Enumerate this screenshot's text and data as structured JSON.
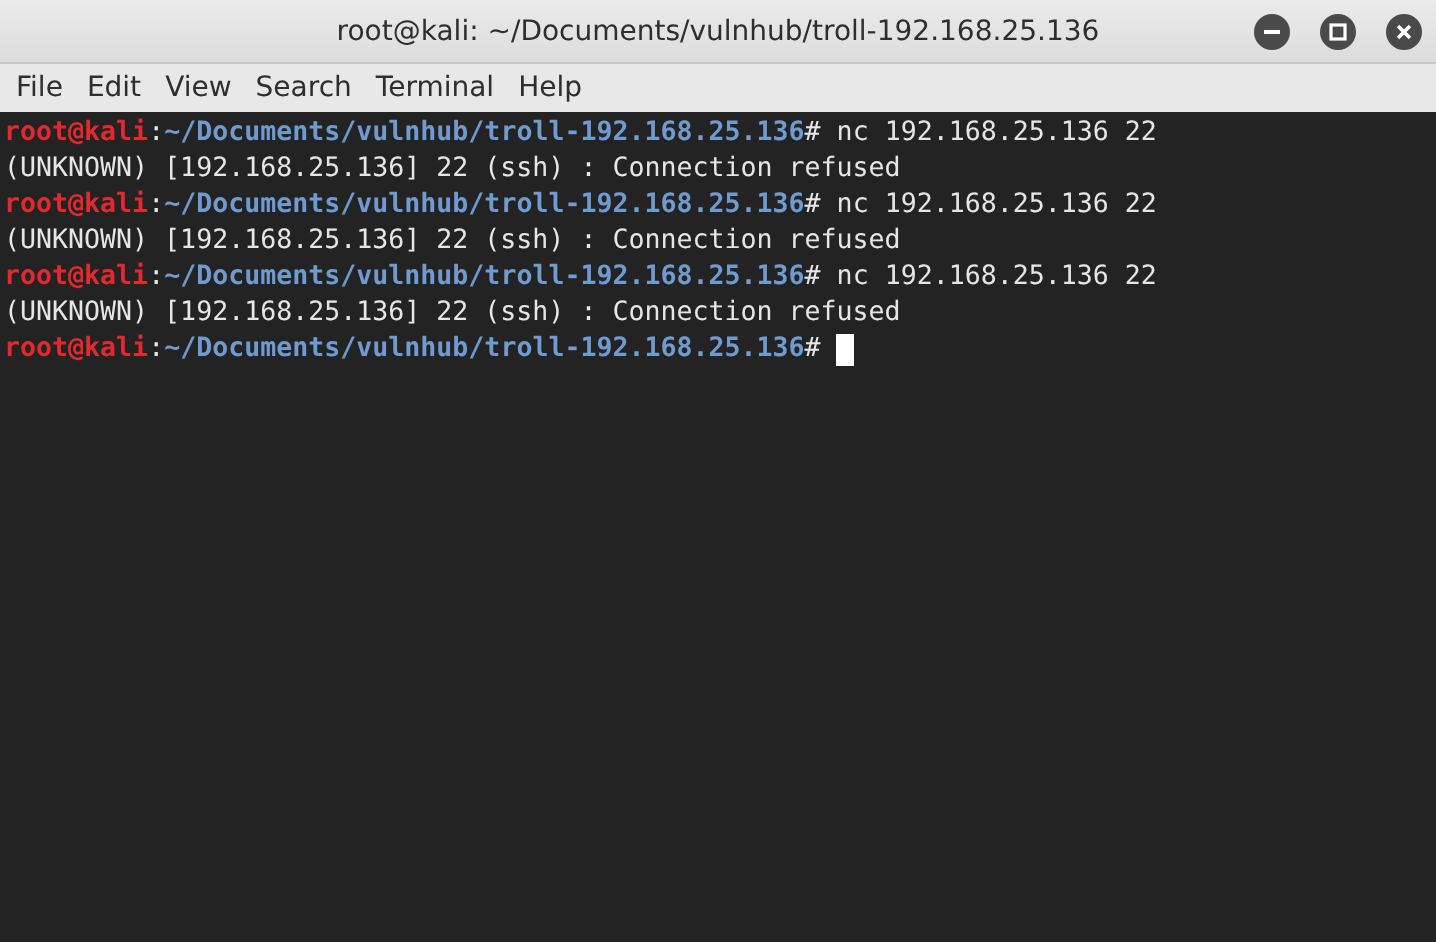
{
  "window": {
    "title": "root@kali: ~/Documents/vulnhub/troll-192.168.25.136"
  },
  "menu": [
    "File",
    "Edit",
    "View",
    "Search",
    "Terminal",
    "Help"
  ],
  "terminal": {
    "lines": [
      {
        "kind": "prompt",
        "user": "root@kali",
        "separator": ":",
        "path": "~/Documents/vulnhub/troll-192.168.25.136",
        "command": "# nc 192.168.25.136 22"
      },
      {
        "kind": "output",
        "text": "(UNKNOWN) [192.168.25.136] 22 (ssh) : Connection refused"
      },
      {
        "kind": "prompt",
        "user": "root@kali",
        "separator": ":",
        "path": "~/Documents/vulnhub/troll-192.168.25.136",
        "command": "# nc 192.168.25.136 22"
      },
      {
        "kind": "output",
        "text": "(UNKNOWN) [192.168.25.136] 22 (ssh) : Connection refused"
      },
      {
        "kind": "prompt",
        "user": "root@kali",
        "separator": ":",
        "path": "~/Documents/vulnhub/troll-192.168.25.136",
        "command": "# nc 192.168.25.136 22"
      },
      {
        "kind": "output",
        "text": "(UNKNOWN) [192.168.25.136] 22 (ssh) : Connection refused"
      },
      {
        "kind": "prompt",
        "user": "root@kali",
        "separator": ":",
        "path": "~/Documents/vulnhub/troll-192.168.25.136",
        "command": "# ",
        "cursor": true
      }
    ]
  }
}
